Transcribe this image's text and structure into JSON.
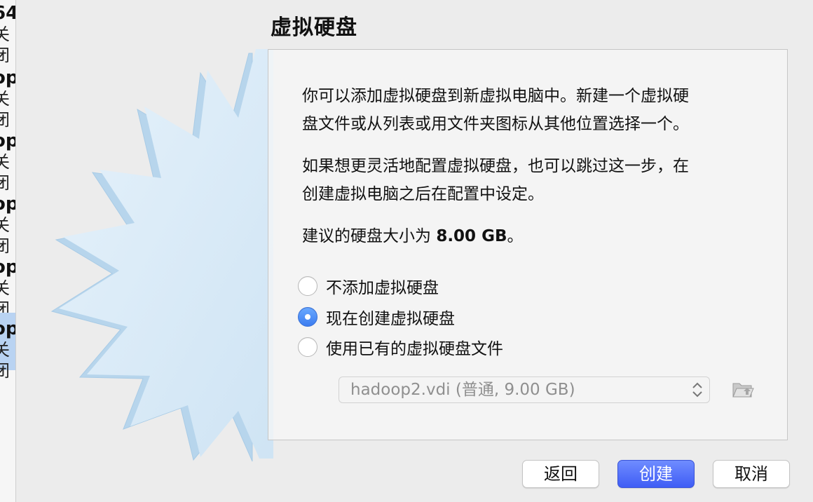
{
  "vm_list": {
    "items": [
      {
        "name": "64",
        "state": "关闭"
      },
      {
        "name": "op",
        "state": "关闭"
      },
      {
        "name": "op",
        "state": "关闭"
      },
      {
        "name": "op",
        "state": "关闭"
      },
      {
        "name": "op",
        "state": "关闭"
      },
      {
        "name": "op",
        "state": "关闭",
        "selected": true
      }
    ]
  },
  "dialog": {
    "title": "虚拟硬盘",
    "intro_line1": "你可以添加虚拟硬盘到新虚拟电脑中。新建一个虚拟硬",
    "intro_line2": "盘文件或从列表或用文件夹图标从其他位置选择一个。",
    "skip_line1": "如果想更灵活地配置虚拟硬盘，也可以跳过这一步，在",
    "skip_line2": "创建虚拟电脑之后在配置中设定。",
    "recommend_prefix": "建议的硬盘大小为",
    "recommend_size": "8.00 GB",
    "recommend_suffix": "。",
    "options": [
      {
        "label": "不添加虚拟硬盘",
        "checked": false
      },
      {
        "label": "现在创建虚拟硬盘",
        "checked": true
      },
      {
        "label": "使用已有的虚拟硬盘文件",
        "checked": false
      }
    ],
    "existing_disk_value": "hadoop2.vdi (普通, 9.00 GB)",
    "buttons": {
      "back": "返回",
      "create": "创建",
      "cancel": "取消"
    }
  },
  "icons": {
    "chevron": "up-down-chevron-icon",
    "folder": "folder-open-icon"
  },
  "colors": {
    "accent": "#3f5df5",
    "radio_selected": "#3b7cf0",
    "selected_row": "#b9d3f2"
  }
}
